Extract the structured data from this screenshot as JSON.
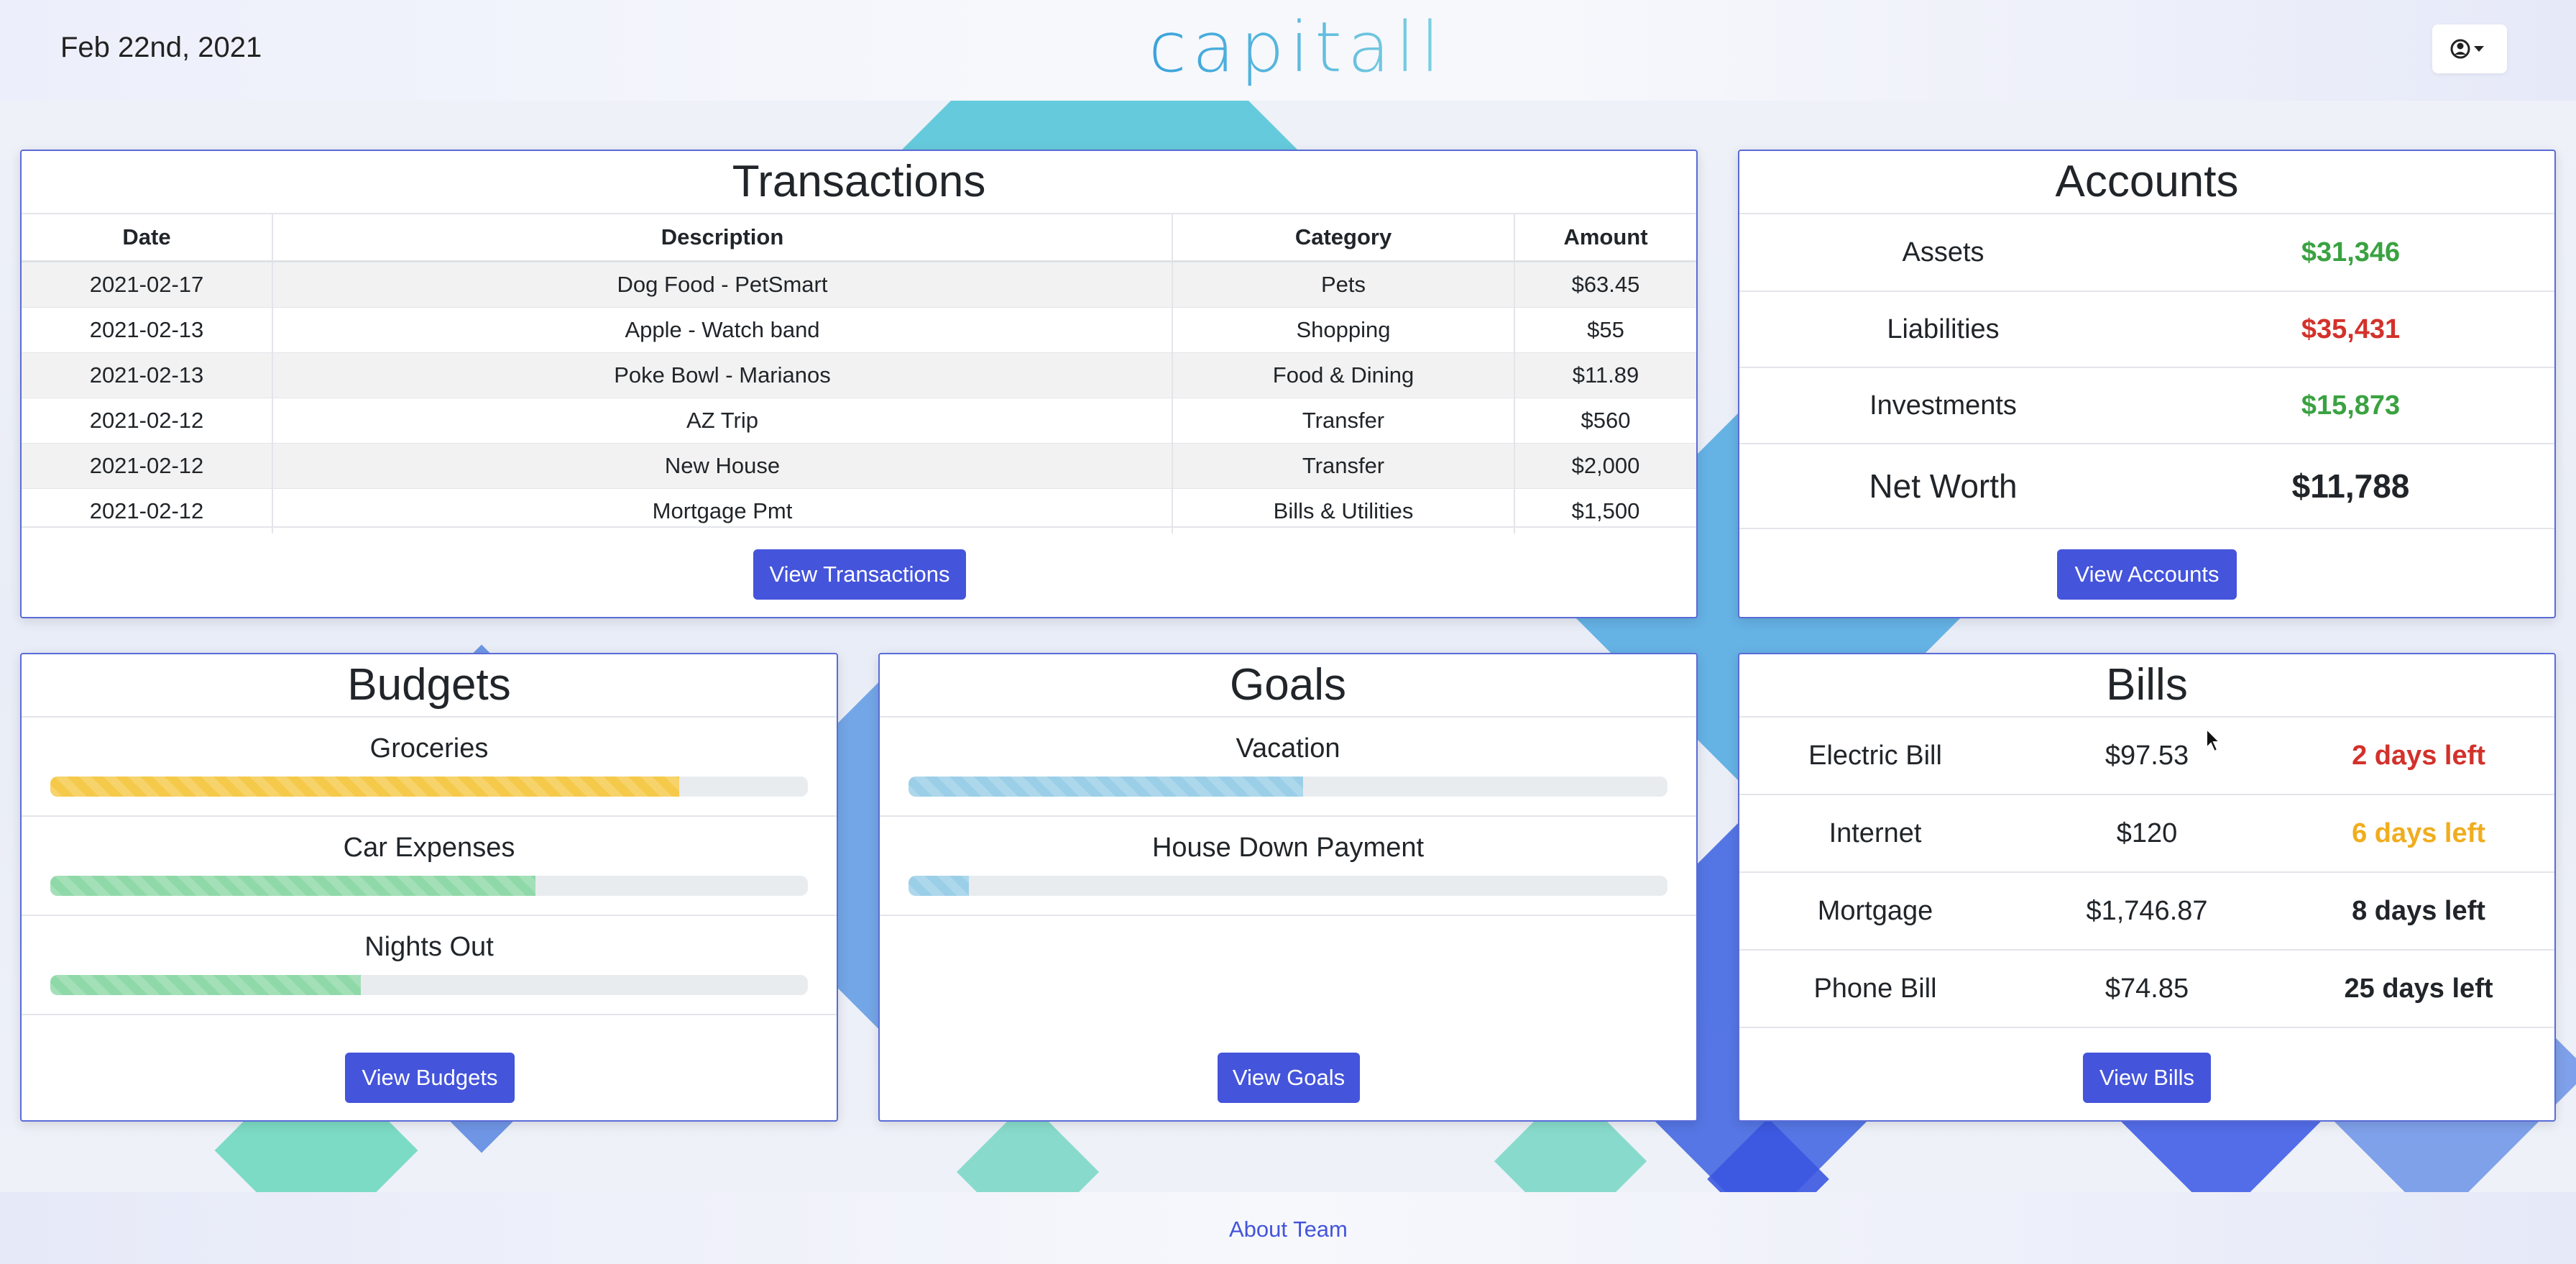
{
  "header": {
    "date": "Feb 22nd, 2021",
    "logo": "capitall",
    "user_icon": "user-circle-icon"
  },
  "transactions": {
    "title": "Transactions",
    "columns": [
      "Date",
      "Description",
      "Category",
      "Amount"
    ],
    "rows": [
      [
        "2021-02-17",
        "Dog Food - PetSmart",
        "Pets",
        "$63.45"
      ],
      [
        "2021-02-13",
        "Apple - Watch band",
        "Shopping",
        "$55"
      ],
      [
        "2021-02-13",
        "Poke Bowl - Marianos",
        "Food & Dining",
        "$11.89"
      ],
      [
        "2021-02-12",
        "AZ Trip",
        "Transfer",
        "$560"
      ],
      [
        "2021-02-12",
        "New House",
        "Transfer",
        "$2,000"
      ],
      [
        "2021-02-12",
        "Mortgage Pmt",
        "Bills & Utilities",
        "$1,500"
      ]
    ],
    "button": "View Transactions"
  },
  "accounts": {
    "title": "Accounts",
    "rows": [
      {
        "label": "Assets",
        "value": "$31,346",
        "color": "#3aa241"
      },
      {
        "label": "Liabilities",
        "value": "$35,431",
        "color": "#d3312b"
      },
      {
        "label": "Investments",
        "value": "$15,873",
        "color": "#3aa241"
      },
      {
        "label": "Net Worth",
        "value": "$11,788",
        "color": "#212529"
      }
    ],
    "button": "View Accounts"
  },
  "budgets": {
    "title": "Budgets",
    "items": [
      {
        "label": "Groceries",
        "progress": 0.83,
        "color": "#f5c94a"
      },
      {
        "label": "Car Expenses",
        "progress": 0.64,
        "color": "#8fd9a8"
      },
      {
        "label": "Nights Out",
        "progress": 0.41,
        "color": "#8fd9a8"
      }
    ],
    "button": "View Budgets"
  },
  "goals": {
    "title": "Goals",
    "items": [
      {
        "label": "Vacation",
        "progress": 0.52,
        "color": "#9bcfe8"
      },
      {
        "label": "House Down Payment",
        "progress": 0.08,
        "color": "#9bcfe8"
      }
    ],
    "button": "View Goals"
  },
  "bills": {
    "title": "Bills",
    "rows": [
      {
        "name": "Electric Bill",
        "amount": "$97.53",
        "due": "2 days left",
        "color": "#d3312b"
      },
      {
        "name": "Internet",
        "amount": "$120",
        "due": "6 days left",
        "color": "#f0ad1e"
      },
      {
        "name": "Mortgage",
        "amount": "$1,746.87",
        "due": "8 days left",
        "color": "#111111"
      },
      {
        "name": "Phone Bill",
        "amount": "$74.85",
        "due": "25 days left",
        "color": "#111111"
      }
    ],
    "button": "View Bills"
  },
  "footer": {
    "link": "About Team"
  }
}
